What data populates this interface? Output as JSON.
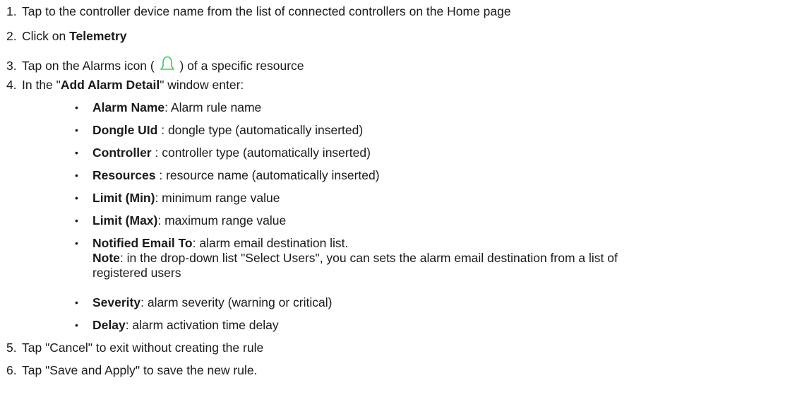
{
  "steps": [
    {
      "num": "1.",
      "text": "Tap to the controller device name from the list of connected controllers on the Home page"
    },
    {
      "num": "2.",
      "pre": "Click on ",
      "bold": "Telemetry"
    },
    {
      "num": "3.",
      "pre": "Tap on the Alarms icon ( ",
      "post": " ) of a specific resource",
      "icon": "bell-icon"
    },
    {
      "num": "4.",
      "pre": "In the \"",
      "bold": "Add Alarm Detail",
      "post": "\" window enter:"
    },
    {
      "num": "5.",
      "text": "Tap \"Cancel\" to exit without creating the rule"
    },
    {
      "num": "6.",
      "text": "Tap \"Save and Apply\" to save the new rule."
    }
  ],
  "fields": [
    {
      "label": "Alarm Name",
      "desc": ": Alarm rule name"
    },
    {
      "label": "Dongle UId",
      "desc": " : dongle type (automatically inserted)"
    },
    {
      "label": "Controller",
      "desc": " : controller type (automatically inserted)"
    },
    {
      "label": "Resources",
      "desc": " : resource name (automatically inserted)"
    },
    {
      "label": "Limit (Min)",
      "desc": ": minimum range value"
    },
    {
      "label": "Limit (Max)",
      "desc": ": maximum range value"
    },
    {
      "label": "Notified Email To",
      "desc": ": alarm email destination list.",
      "note_label": "Note",
      "note_line1": ": in the drop-down list \"Select Users\", you can sets the alarm email destination from a list of",
      "note_line2": "registered users"
    },
    {
      "label": "Severity",
      "desc": ": alarm severity (warning or critical)"
    },
    {
      "label": "Delay",
      "desc": ": alarm activation time delay"
    }
  ],
  "bullet_symbol": "•",
  "icon_color": "#3dcd58"
}
